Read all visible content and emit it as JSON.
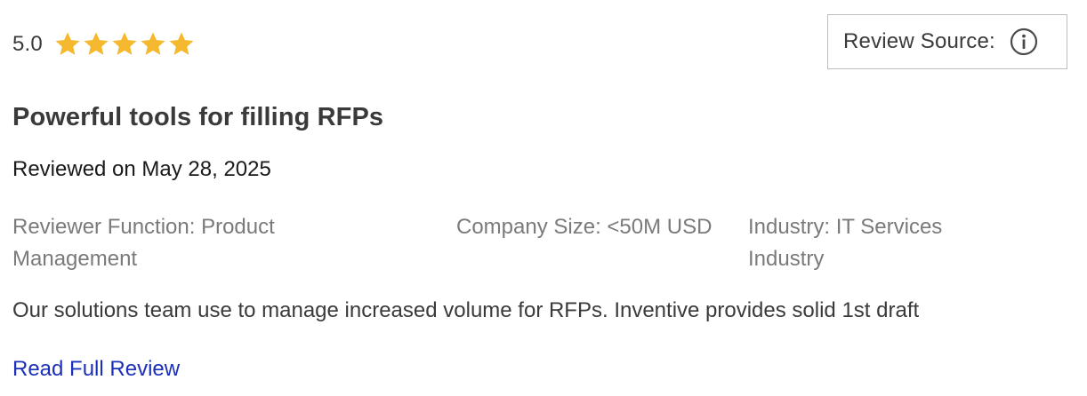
{
  "rating": {
    "value": "5.0",
    "stars": 5,
    "max_stars": 5,
    "star_icon": "star-icon",
    "star_color": "#F5B82E"
  },
  "review_source": {
    "label": "Review Source:",
    "icon": "info-icon"
  },
  "review": {
    "title": "Powerful tools for filling RFPs",
    "date": "Reviewed on May 28, 2025",
    "reviewer_function": "Reviewer Function: Product Management",
    "company_size": "Company Size: <50M USD",
    "industry": "Industry: IT Services Industry",
    "summary": "Our solutions team use to manage increased volume for RFPs. Inventive provides solid 1st draft",
    "read_more_label": "Read Full Review",
    "link_color": "#1C2FB8"
  }
}
